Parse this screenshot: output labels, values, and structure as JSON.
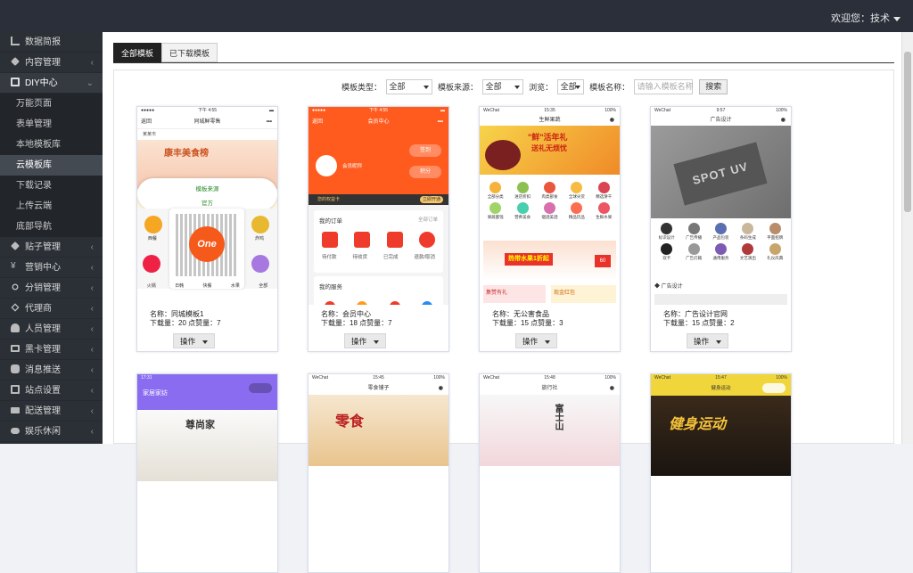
{
  "topbar": {
    "user_label": "欢迎您：技术"
  },
  "sidebar": {
    "items": [
      {
        "label": "数据简报",
        "icon": "bar-chart-icon",
        "arrow": ""
      },
      {
        "label": "内容管理",
        "icon": "tag-icon",
        "arrow": "‹"
      },
      {
        "label": "DIY中心",
        "icon": "monitor-icon",
        "arrow": "⌄"
      },
      {
        "label": "贴子管理",
        "icon": "tag-icon",
        "arrow": "‹"
      },
      {
        "label": "营销中心",
        "icon": "yen-icon",
        "arrow": "‹"
      },
      {
        "label": "分销管理",
        "icon": "share-icon",
        "arrow": "‹"
      },
      {
        "label": "代理商",
        "icon": "diamond-icon",
        "arrow": "‹"
      },
      {
        "label": "人员管理",
        "icon": "users-icon",
        "arrow": "‹"
      },
      {
        "label": "黑卡管理",
        "icon": "card-icon",
        "arrow": "‹"
      },
      {
        "label": "消息推送",
        "icon": "chat-icon",
        "arrow": "‹"
      },
      {
        "label": "站点设置",
        "icon": "monitor-icon",
        "arrow": "‹"
      },
      {
        "label": "配送管理",
        "icon": "truck-icon",
        "arrow": "‹"
      },
      {
        "label": "娱乐休闲",
        "icon": "gamepad-icon",
        "arrow": "‹"
      }
    ],
    "subitems": [
      "万能页面",
      "表单管理",
      "本地模板库",
      "云模板库",
      "下载记录",
      "上传云端",
      "底部导航"
    ],
    "active_subitem": "云模板库"
  },
  "tabs": [
    "全部模板",
    "已下载模板"
  ],
  "filters": {
    "type_label": "模板类型：",
    "type_value": "全部",
    "source_label": "模板来源：",
    "source_value": "全部",
    "browse_label": "浏览：",
    "browse_value": "全部",
    "name_label": "模板名称：",
    "name_placeholder": "请输入模板名称",
    "search_label": "搜索"
  },
  "cards": [
    {
      "name": "名称：同城模板1",
      "downloads": "下载量：20",
      "likes": "点赞量：7",
      "ops": "操作",
      "phone": {
        "time": "下午 4:55",
        "title": "同城鲜零售",
        "back": "返回",
        "city": "某某市",
        "banner": "康丰美食榜",
        "popup_title": "模板来源",
        "popup_value": "官方",
        "qr_text": "One",
        "cats": [
          "西餐",
          "",
          "",
          "",
          "炸鸡"
        ],
        "bottom": [
          "火锅",
          "日韩",
          "快餐",
          "水果",
          "全部"
        ]
      }
    },
    {
      "name": "名称：会员中心",
      "downloads": "下载量：18",
      "likes": "点赞量：7",
      "ops": "操作",
      "phone": {
        "time": "下午 4:55",
        "title": "会员中心",
        "back": "返回",
        "nickname": "会员昵称",
        "sign": "签到",
        "points": "积分",
        "notice": "您的权益卡",
        "notice_btn": "立即开通",
        "orders_title": "我的订单",
        "orders_all": "全部订单",
        "orders": [
          "待付款",
          "待收货",
          "已完成",
          "退款/取消"
        ],
        "services_title": "我的服务"
      }
    },
    {
      "name": "名称：无公害食品",
      "downloads": "下载量：15",
      "likes": "点赞量：3",
      "ops": "操作",
      "phone": {
        "time": "15:35",
        "carrier": "WeChat",
        "battery": "100%",
        "title": "生鲜果蔬",
        "banner_a": "\"鲜\"活年礼",
        "banner_b": "送礼无烦忧",
        "icons": [
          "全部分类",
          "进店折扣",
          "肉类部食",
          "全球尖货",
          "精选饼干",
          "果蔬蜜饯",
          "营养美食",
          "烟酒美酒",
          "精品饮品",
          "生鲜水果"
        ],
        "promo": "热带水果1折起",
        "promo_num": "60",
        "coupon_a": "集赞有礼",
        "coupon_b": "现金红包"
      }
    },
    {
      "name": "名称：广告设计官网",
      "downloads": "下载量：15",
      "likes": "点赞量：2",
      "ops": "操作",
      "phone": {
        "time": "9:57",
        "carrier": "WeChat",
        "battery": "100%",
        "title": "广告设计",
        "hero": "SPOT UV",
        "icons": [
          "标识设计",
          "广告传播",
          "产品包装",
          "条码生成",
          "平面招牌",
          "双卡",
          "广告灯箱",
          "通用服务",
          "文艺演出",
          "礼仪庆典"
        ],
        "section": "广告设计"
      }
    },
    {
      "name": "",
      "downloads": "",
      "likes": "",
      "ops": "",
      "phone": {
        "time": "17:31",
        "title": "家居家纺",
        "hero": "尊尚家"
      }
    },
    {
      "name": "",
      "downloads": "",
      "likes": "",
      "ops": "",
      "phone": {
        "time": "15:45",
        "carrier": "WeChat",
        "battery": "100%",
        "title": "零食铺子",
        "hero": "零食"
      }
    },
    {
      "name": "",
      "downloads": "",
      "likes": "",
      "ops": "",
      "phone": {
        "time": "15:48",
        "carrier": "WeChat",
        "battery": "100%",
        "title": "旅行社",
        "hero": "富士山"
      }
    },
    {
      "name": "",
      "downloads": "",
      "likes": "",
      "ops": "",
      "phone": {
        "time": "15:47",
        "carrier": "WeChat",
        "battery": "100%",
        "title": "健身运动",
        "hero": "健身运动"
      }
    }
  ],
  "colors": {
    "topbar": "#2a2f3a",
    "sidebar": "#2b3036",
    "accent_orange": "#ff5b1f",
    "accent_purple": "#8a6cf0",
    "accent_yellow": "#f0d63a",
    "active_tab": "#222222"
  }
}
